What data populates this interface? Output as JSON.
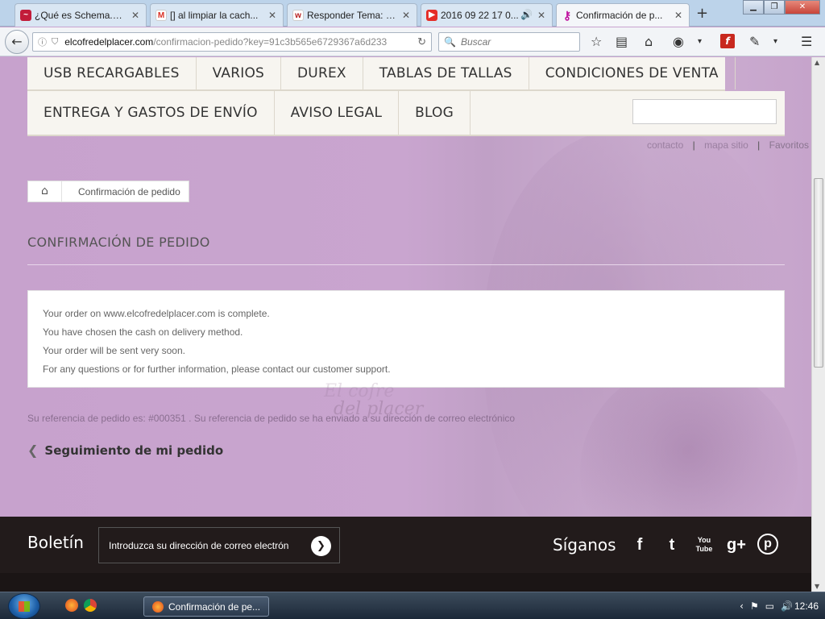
{
  "browser": {
    "tabs": [
      {
        "label": "¿Qué es Schema.or...",
        "icon": "schema-icon",
        "color": "#c21c3a"
      },
      {
        "label": "[] al limpiar la cach...",
        "icon": "gmail-icon",
        "color": "#d93025"
      },
      {
        "label": "Responder Tema: a...",
        "icon": "forum-icon",
        "color": "#b71c1c"
      },
      {
        "label": "2016 09 22 17 0...",
        "icon": "youtube-icon",
        "color": "#e52d27"
      },
      {
        "label": "Confirmación de p...",
        "icon": "keyhole-icon",
        "color": "#c0119f"
      }
    ],
    "url_host": "elcofredelplacer.com",
    "url_path": "/confirmacion-pedido?key=91c3b565e6729367a6d233",
    "search_placeholder": "Buscar"
  },
  "menu": {
    "row1": [
      "USB RECARGABLES",
      "VARIOS",
      "DUREX",
      "TABLAS DE TALLAS",
      "CONDICIONES DE VENTA"
    ],
    "row2": [
      "ENTREGA Y GASTOS DE ENVÍO",
      "AVISO LEGAL",
      "BLOG"
    ]
  },
  "toplinks": {
    "contact": "contacto",
    "sitemap": "mapa sitio",
    "favorites": "Favoritos",
    "sep": "|"
  },
  "breadcrumb": {
    "current": "Confirmación de pedido"
  },
  "page": {
    "heading": "CONFIRMACIÓN DE PEDIDO",
    "messages": [
      "Your order on www.elcofredelplacer.com is complete.",
      "You have chosen the cash on delivery method.",
      "Your order will be sent very soon.",
      "For any questions or for further information, please contact our customer support."
    ],
    "reference": "Su referencia de pedido es: #000351 . Su referencia de pedido se ha enviado a su dirección de correo electrónico",
    "follow_link": "Seguimiento de mi pedido",
    "watermark_line1": "El cofre",
    "watermark_line2": "del placer"
  },
  "footer": {
    "newsletter_title": "Boletín",
    "newsletter_placeholder": "Introduzca su dirección de correo electrón",
    "follow_title": "Síganos",
    "social": [
      "f",
      "t",
      "You Tube",
      "g+",
      "p"
    ]
  },
  "taskbar": {
    "active_window": "Confirmación de pe...",
    "time": "12:46"
  },
  "colors": {
    "menu_bg": "#f7f5f0",
    "page_bg": "#c9a3cf",
    "footer_bg": "#221b1b"
  }
}
